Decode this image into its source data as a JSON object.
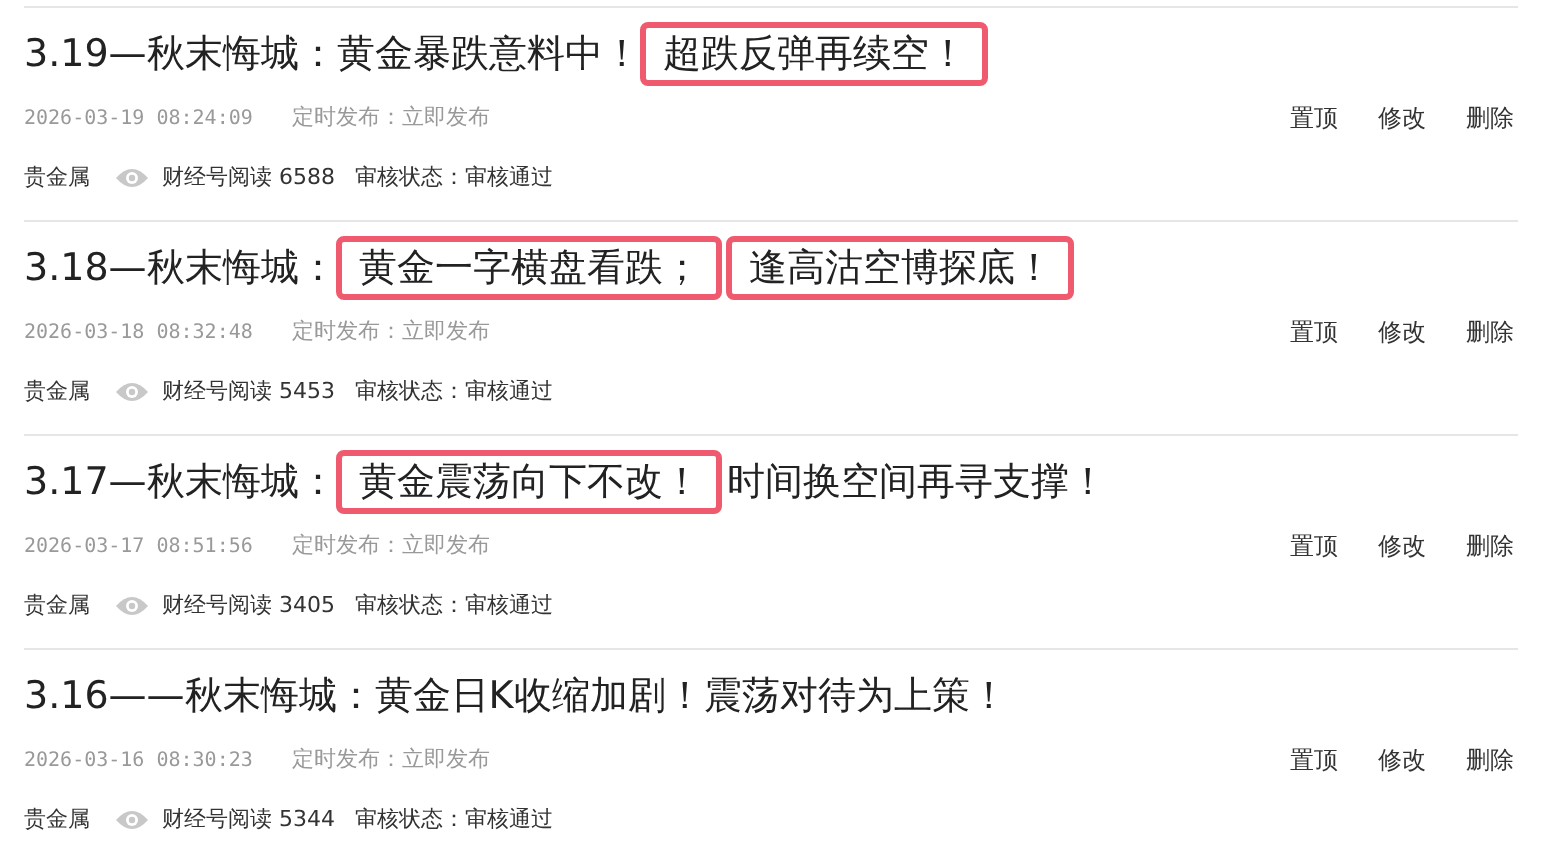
{
  "articles": [
    {
      "title": [
        {
          "text": "3.19—秋末悔城：黄金暴跌意料中！",
          "highlighted": false
        },
        {
          "text": "超跌反弹再续空！",
          "highlighted": true
        }
      ],
      "time": "2026-03-19 08:24:09",
      "schedule": "定时发布：立即发布",
      "author": "贵金属",
      "reads": "财经号阅读 6588",
      "status": "审核状态：审核通过",
      "actions": [
        "置顶",
        "修改",
        "删除"
      ]
    },
    {
      "title": [
        {
          "text": "3.18—秋末悔城：",
          "highlighted": false
        },
        {
          "text": "黄金一字横盘看跌；",
          "highlighted": true
        },
        {
          "text": "逢高沽空博探底！",
          "highlighted": true
        }
      ],
      "time": "2026-03-18 08:32:48",
      "schedule": "定时发布：立即发布",
      "author": "贵金属",
      "reads": "财经号阅读 5453",
      "status": "审核状态：审核通过",
      "actions": [
        "置顶",
        "修改",
        "删除"
      ]
    },
    {
      "title": [
        {
          "text": "3.17—秋末悔城：",
          "highlighted": false
        },
        {
          "text": "黄金震荡向下不改！",
          "highlighted": true
        },
        {
          "text": "时间换空间再寻支撑！",
          "highlighted": false
        }
      ],
      "time": "2026-03-17 08:51:56",
      "schedule": "定时发布：立即发布",
      "author": "贵金属",
      "reads": "财经号阅读 3405",
      "status": "审核状态：审核通过",
      "actions": [
        "置顶",
        "修改",
        "删除"
      ]
    },
    {
      "title": [
        {
          "text": "3.16——秋末悔城：黄金日K收缩加剧！震荡对待为上策！",
          "highlighted": false
        }
      ],
      "time": "2026-03-16 08:30:23",
      "schedule": "定时发布：立即发布",
      "author": "贵金属",
      "reads": "财经号阅读 5344",
      "status": "审核状态：审核通过",
      "actions": [
        "置顶",
        "修改",
        "删除"
      ]
    }
  ]
}
